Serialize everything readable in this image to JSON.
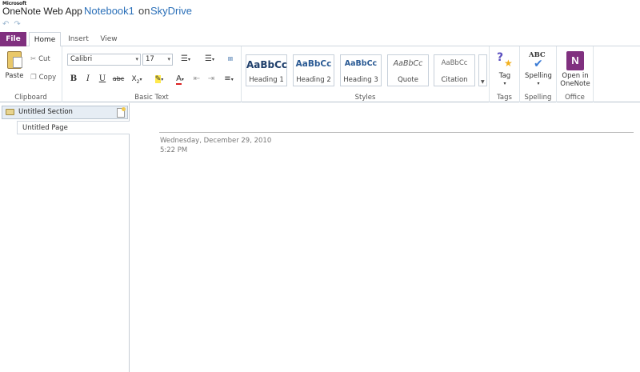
{
  "app": {
    "vendor": "Microsoft",
    "name": "OneNote Web App",
    "notebook": "Notebook1",
    "on_word": "on",
    "service": "SkyDrive"
  },
  "qat": {
    "undo_icon": "undo-icon",
    "redo_icon": "redo-icon"
  },
  "tabs": [
    {
      "label": "File"
    },
    {
      "label": "Home"
    },
    {
      "label": "Insert"
    },
    {
      "label": "View"
    }
  ],
  "ribbon": {
    "clipboard": {
      "label": "Clipboard",
      "paste": "Paste",
      "cut": "Cut",
      "copy": "Copy"
    },
    "basic_text": {
      "label": "Basic Text",
      "font": "Calibri",
      "size": "17"
    },
    "styles": {
      "label": "Styles",
      "items": [
        {
          "sample": "AaBbCc",
          "name": "Heading 1"
        },
        {
          "sample": "AaBbCc",
          "name": "Heading 2"
        },
        {
          "sample": "AaBbCc",
          "name": "Heading 3"
        },
        {
          "sample": "AaBbCc",
          "name": "Quote"
        },
        {
          "sample": "AaBbCc",
          "name": "Citation"
        }
      ]
    },
    "tags": {
      "label": "Tags",
      "tag": "Tag"
    },
    "spelling": {
      "label": "Spelling",
      "button": "Spelling",
      "icon_text": "ABC"
    },
    "office": {
      "label": "Office",
      "open_line1": "Open in",
      "open_line2": "OneNote"
    }
  },
  "nav": {
    "section": "Untitled Section",
    "page": "Untitled Page"
  },
  "page": {
    "date": "Wednesday, December 29, 2010",
    "time": "5:22 PM"
  },
  "colors": {
    "file_tab": "#80307f",
    "link": "#2a6fb8"
  }
}
